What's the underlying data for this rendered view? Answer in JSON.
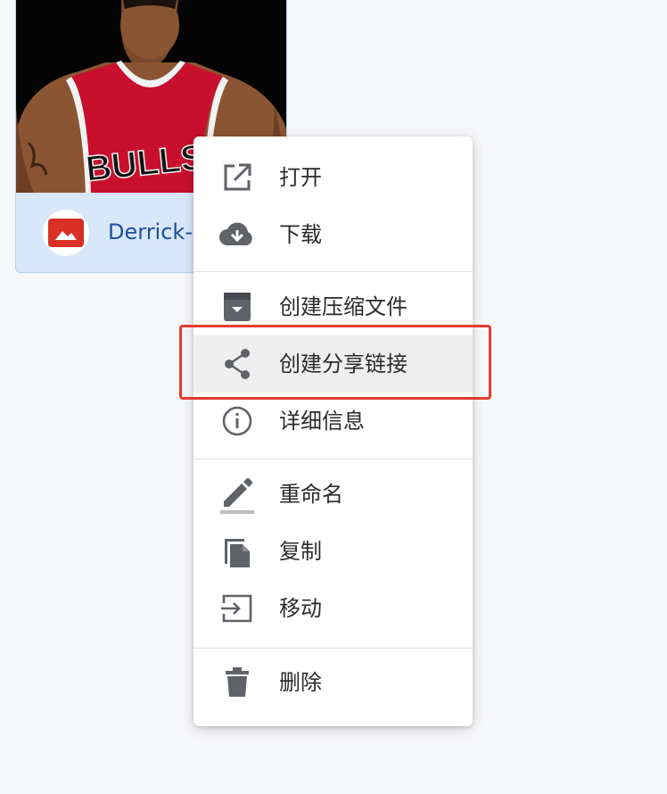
{
  "file": {
    "name": "Derrick-R",
    "thumbnail_jersey_text": "BULLS",
    "type_icon": "image-icon"
  },
  "menu": {
    "items": [
      {
        "label": "打开",
        "icon": "open-in-new-icon"
      },
      {
        "label": "下载",
        "icon": "cloud-download-icon"
      },
      {
        "label": "创建压缩文件",
        "icon": "archive-icon"
      },
      {
        "label": "创建分享链接",
        "icon": "share-icon",
        "highlighted": true
      },
      {
        "label": "详细信息",
        "icon": "info-icon"
      },
      {
        "label": "重命名",
        "icon": "pencil-icon"
      },
      {
        "label": "复制",
        "icon": "copy-icon"
      },
      {
        "label": "移动",
        "icon": "move-icon"
      },
      {
        "label": "删除",
        "icon": "trash-icon"
      }
    ]
  },
  "colors": {
    "accent_red": "#e43c32",
    "file_card_bg": "#d9e7fb",
    "file_name_blue": "#1b4f9c",
    "icon_gray": "#5f6368",
    "image_icon_red": "#d93025"
  }
}
